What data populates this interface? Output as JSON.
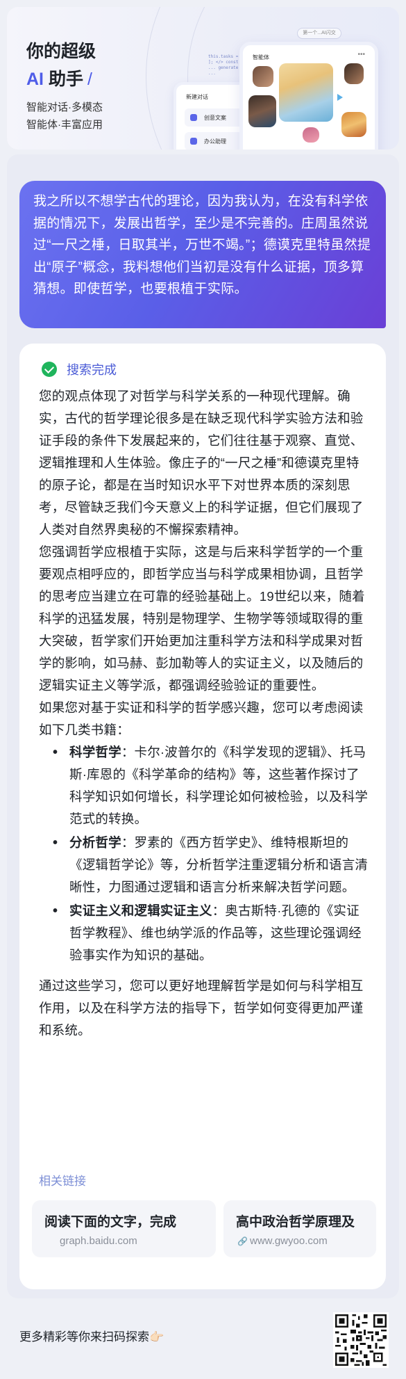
{
  "header": {
    "title_line1": "你的超级",
    "title_ai": "AI",
    "title_helper": "助手",
    "title_slash": "/",
    "subtitle1": "智能对话·多模态",
    "subtitle2": "智能体·丰富应用",
    "mock_pill": "第一个...AI闪交",
    "mock_back_header": "新建对话",
    "mock_back_row1": "创意文案",
    "mock_back_row2": "办公助理",
    "mock_front_header": "智能体",
    "mock_code": "this.tasks = [ ];\n</>\nconst ...\ngenerate ..."
  },
  "conversation": {
    "user_message": "我之所以不想学古代的理论，因为我认为，在没有科学依据的情况下，发展出哲学，至少是不完善的。庄周虽然说过“一尺之棰，日取其半，万世不竭。”；德谟克里特虽然提出“原子”概念，我料想他们当初是没有什么证据，顶多算猜想。即使哲学，也要根植于实际。",
    "status_label": "搜索完成",
    "paragraph1": "您的观点体现了对哲学与科学关系的一种现代理解。确实，古代的哲学理论很多是在缺乏现代科学实验方法和验证手段的条件下发展起来的，它们往往基于观察、直觉、逻辑推理和人生体验。像庄子的“一尺之棰”和德谟克里特的原子论，都是在当时知识水平下对世界本质的深刻思考，尽管缺乏我们今天意义上的科学证据，但它们展现了人类对自然界奥秘的不懈探索精神。",
    "paragraph2": "您强调哲学应根植于实际，这是与后来科学哲学的一个重要观点相呼应的，即哲学应当与科学成果相协调，且哲学的思考应当建立在可靠的经验基础上。19世纪以来，随着科学的迅猛发展，特别是物理学、生物学等领域取得的重大突破，哲学家们开始更加注重科学方法和科学成果对哲学的影响，如马赫、彭加勒等人的实证主义，以及随后的逻辑实证主义等学派，都强调经验验证的重要性。",
    "paragraph3": "如果您对基于实证和科学的哲学感兴趣，您可以考虑阅读如下几类书籍：",
    "books": [
      {
        "title": "科学哲学",
        "text": "：卡尔·波普尔的《科学发现的逻辑》、托马斯·库恩的《科学革命的结构》等，这些著作探讨了科学知识如何增长，科学理论如何被检验，以及科学范式的转换。"
      },
      {
        "title": "分析哲学",
        "text": "：罗素的《西方哲学史》、维特根斯坦的《逻辑哲学论》等，分析哲学注重逻辑分析和语言清晰性，力图通过逻辑和语言分析来解决哲学问题。"
      },
      {
        "title": "实证主义和逻辑实证主义",
        "text": "：奥古斯特·孔德的《实证哲学教程》、维也纳学派的作品等，这些理论强调经验事实作为知识的基础。"
      }
    ],
    "paragraph4": "通过这些学习，您可以更好地理解哲学是如何与科学相互作用，以及在科学方法的指导下，哲学如何变得更加严谨和系统。",
    "related_title": "相关链接",
    "related": [
      {
        "title": "阅读下面的文字，完成",
        "url": "graph.baidu.com"
      },
      {
        "title": "高中政治哲学原理及",
        "url": "www.gwyoo.com"
      }
    ]
  },
  "footer": {
    "text": "更多精彩等你来扫码探索👉🏻"
  },
  "colors": {
    "accent": "#4f5de8",
    "bubble_start": "#6b72f0",
    "bubble_end": "#6a3fd6",
    "success": "#1fb45c",
    "link_gray": "#8a8f99"
  }
}
